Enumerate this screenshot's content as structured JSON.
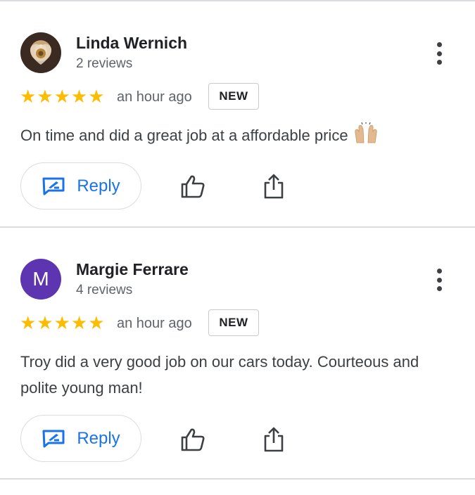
{
  "reviews": [
    {
      "name": "Linda Wernich",
      "review_count": "2 reviews",
      "avatar_type": "photo",
      "avatar_letter": "",
      "rating": 5,
      "stars": "★★★★★",
      "time": "an hour ago",
      "badge": "NEW",
      "text": "On time and did a great job at a affordable price",
      "emoji": "raising-hands-emoji",
      "reply_label": "Reply"
    },
    {
      "name": "Margie Ferrare",
      "review_count": "4 reviews",
      "avatar_type": "letter",
      "avatar_letter": "M",
      "rating": 5,
      "stars": "★★★★★",
      "time": "an hour ago",
      "badge": "NEW",
      "text": "Troy did a very good job on our cars today. Courteous and polite young man!",
      "reply_label": "Reply"
    }
  ],
  "icons": {
    "more": "more-vert-icon",
    "reply": "reply-edit-icon",
    "like": "thumbs-up-icon",
    "share": "share-icon"
  },
  "colors": {
    "star": "#fbbc04",
    "accent": "#1a73e8",
    "avatar_letter_bg": "#5e35b1",
    "divider": "#dadce0"
  }
}
